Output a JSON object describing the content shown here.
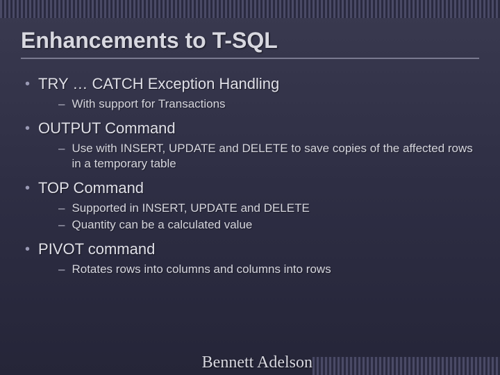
{
  "title": "Enhancements to T-SQL",
  "bullets": [
    {
      "text": "TRY … CATCH Exception Handling",
      "sub": [
        "With support for Transactions"
      ]
    },
    {
      "text": "OUTPUT Command",
      "sub": [
        "Use with INSERT, UPDATE and DELETE to save copies of the affected rows in a temporary table"
      ]
    },
    {
      "text": "TOP Command",
      "sub": [
        "Supported in INSERT, UPDATE and DELETE",
        "Quantity can be a calculated value"
      ]
    },
    {
      "text": "PIVOT command",
      "sub": [
        "Rotates rows into columns and columns into rows"
      ]
    }
  ],
  "footer": "Bennett Adelson"
}
